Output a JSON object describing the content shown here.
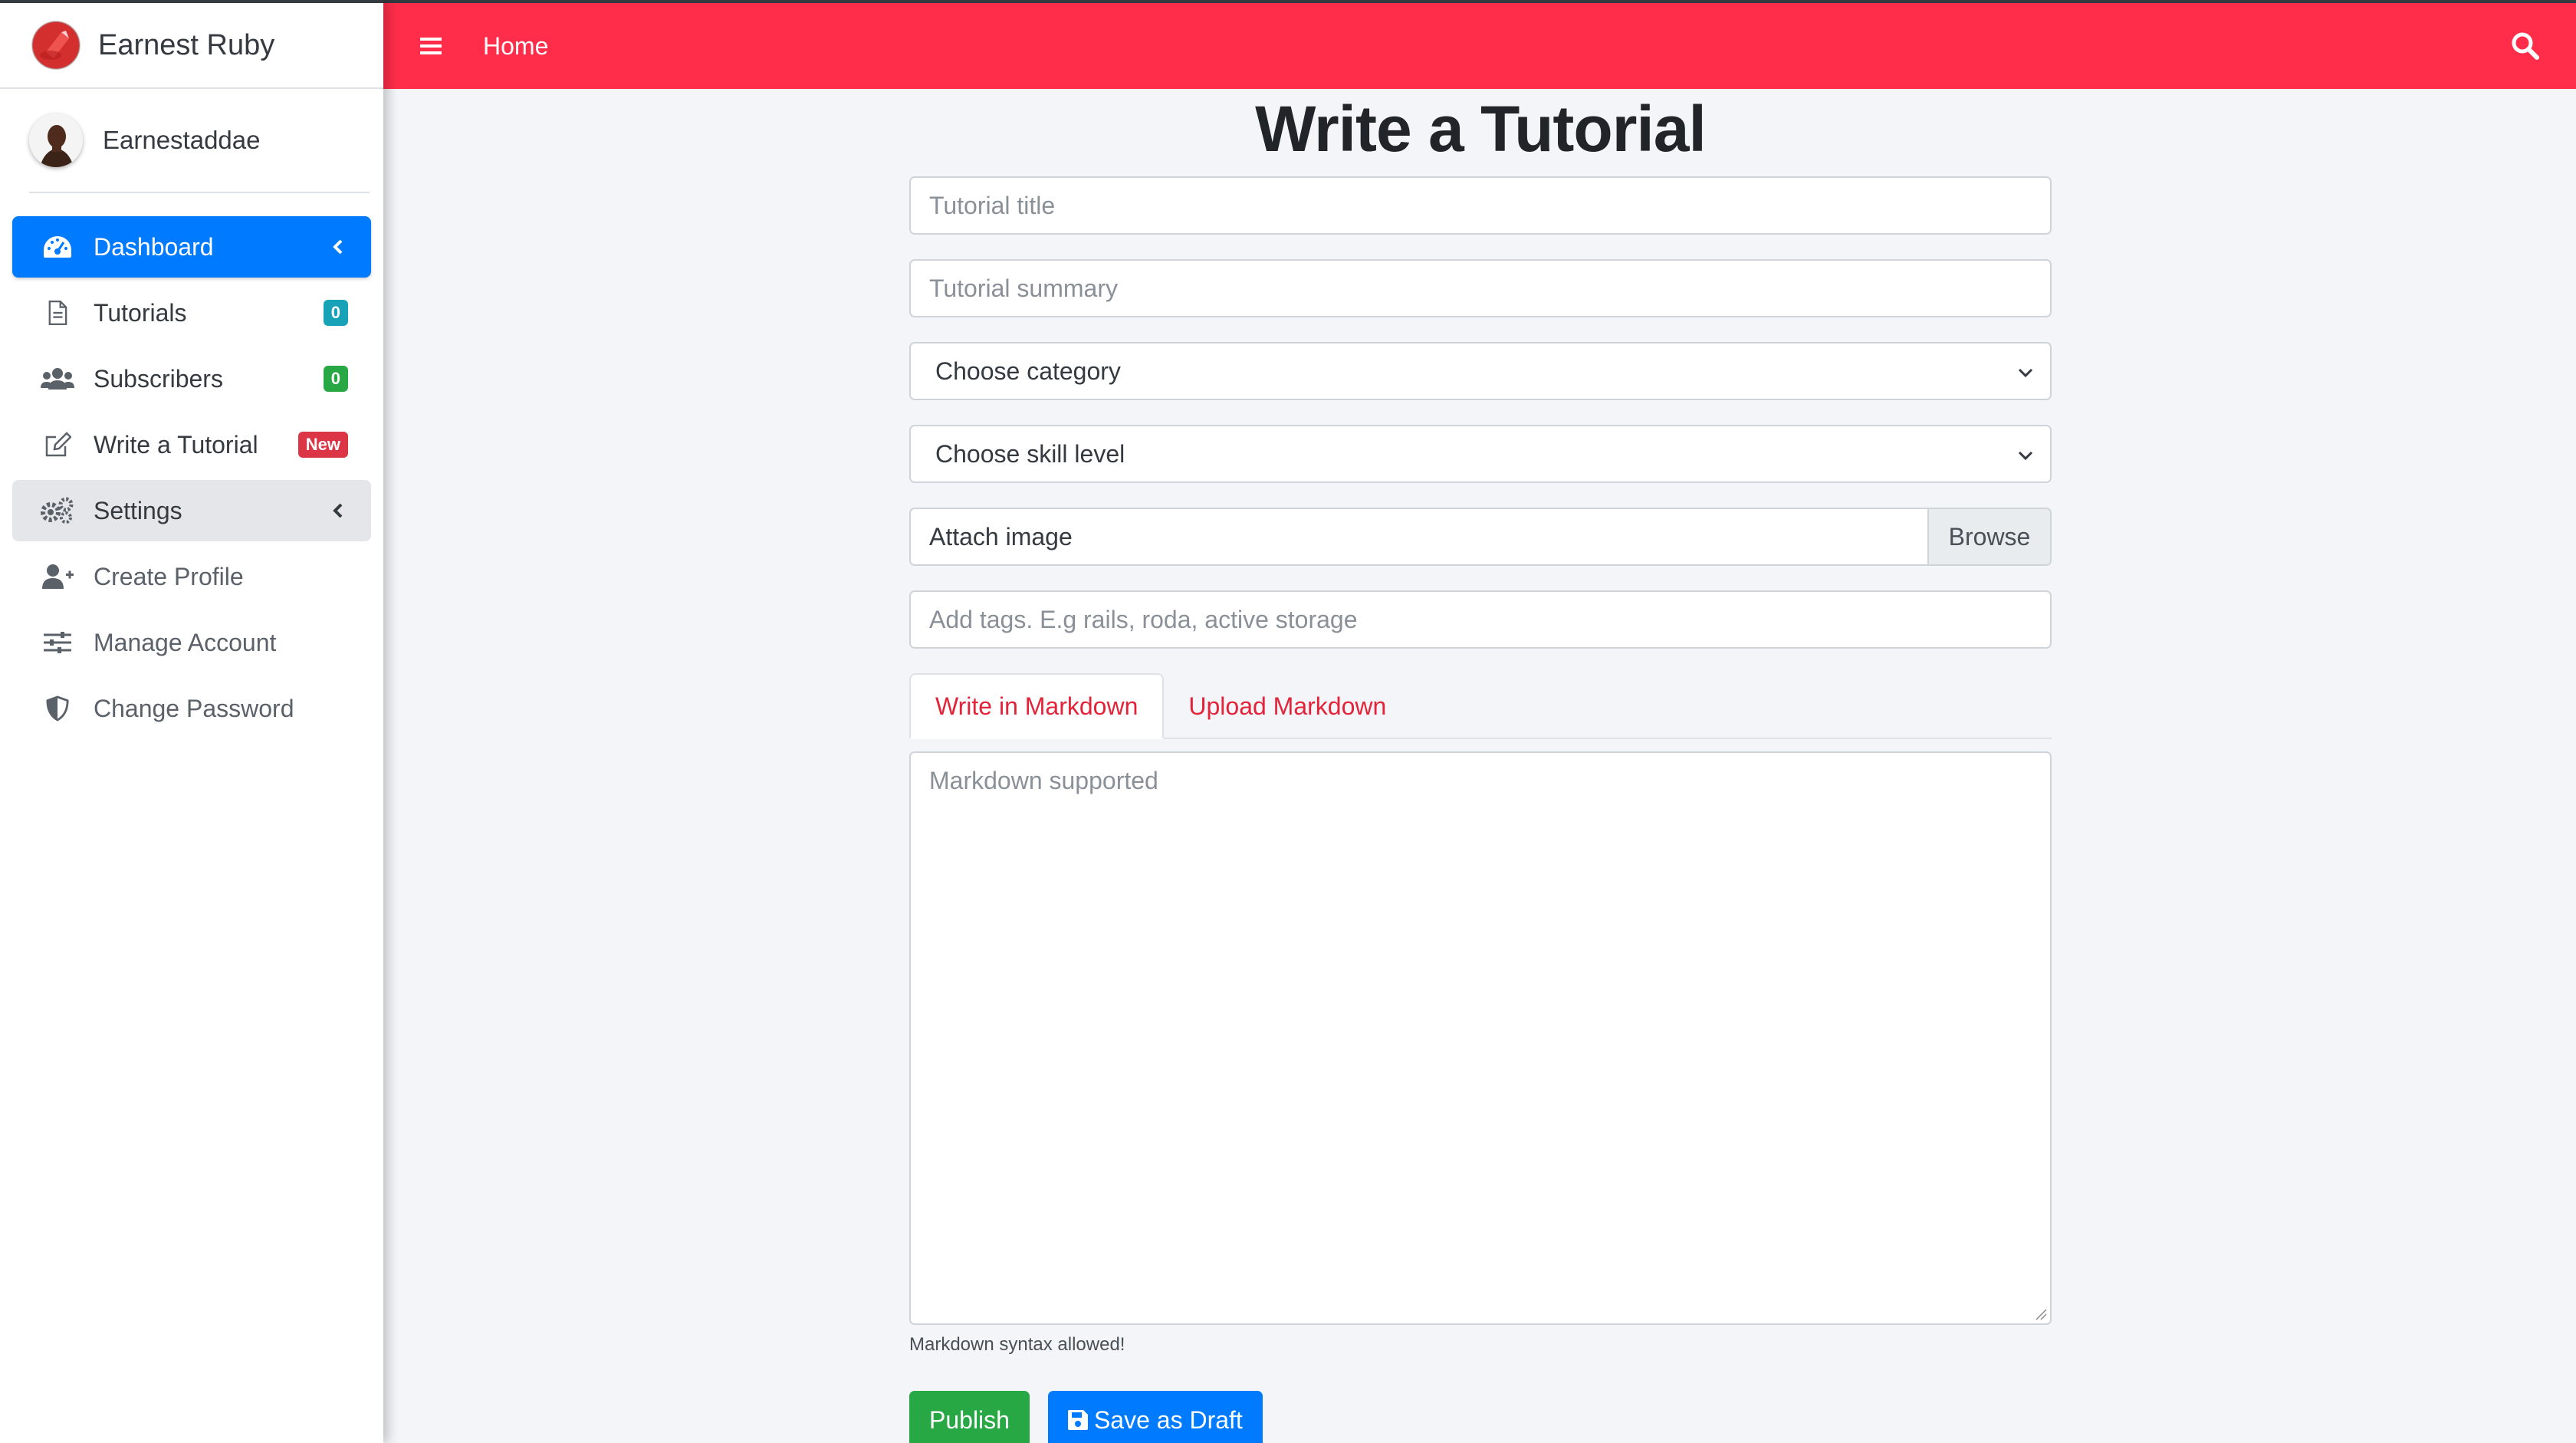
{
  "brand": {
    "name": "Earnest Ruby",
    "logo_icon": "ruby-logo-icon"
  },
  "user": {
    "name": "Earnestaddae"
  },
  "sidebar": {
    "items": [
      {
        "label": "Dashboard",
        "icon": "tachometer-icon",
        "state": "active",
        "has_chevron": true
      },
      {
        "label": "Tutorials",
        "icon": "file-icon",
        "badge": "0",
        "badge_color": "#17a2b8"
      },
      {
        "label": "Subscribers",
        "icon": "users-icon",
        "badge": "0",
        "badge_color": "#28a745"
      },
      {
        "label": "Write a Tutorial",
        "icon": "edit-icon",
        "badge": "New",
        "badge_color": "#dc3545"
      },
      {
        "label": "Settings",
        "icon": "cogs-icon",
        "state": "open",
        "has_chevron": true
      },
      {
        "label": "Create Profile",
        "icon": "user-plus-icon"
      },
      {
        "label": "Manage Account",
        "icon": "sliders-icon"
      },
      {
        "label": "Change Password",
        "icon": "shield-icon"
      }
    ]
  },
  "header": {
    "home_label": "Home",
    "menu_icon": "hamburger-icon",
    "search_icon": "search-icon"
  },
  "form": {
    "title": "Write a Tutorial",
    "title_placeholder": "Tutorial title",
    "summary_placeholder": "Tutorial summary",
    "category_selected": "Choose category",
    "skill_selected": "Choose skill level",
    "image_label": "Attach image",
    "browse_label": "Browse",
    "tags_placeholder": "Add tags. E.g rails, roda, active storage",
    "tabs": [
      "Write in Markdown",
      "Upload Markdown"
    ],
    "markdown_placeholder": "Markdown supported",
    "hint": "Markdown syntax allowed!",
    "publish_label": "Publish",
    "draft_label": "Save as Draft"
  },
  "colors": {
    "header": "#ff2d49",
    "active_nav": "#007bff",
    "tab_text": "#e32339",
    "publish": "#28a745",
    "draft": "#007bff"
  }
}
